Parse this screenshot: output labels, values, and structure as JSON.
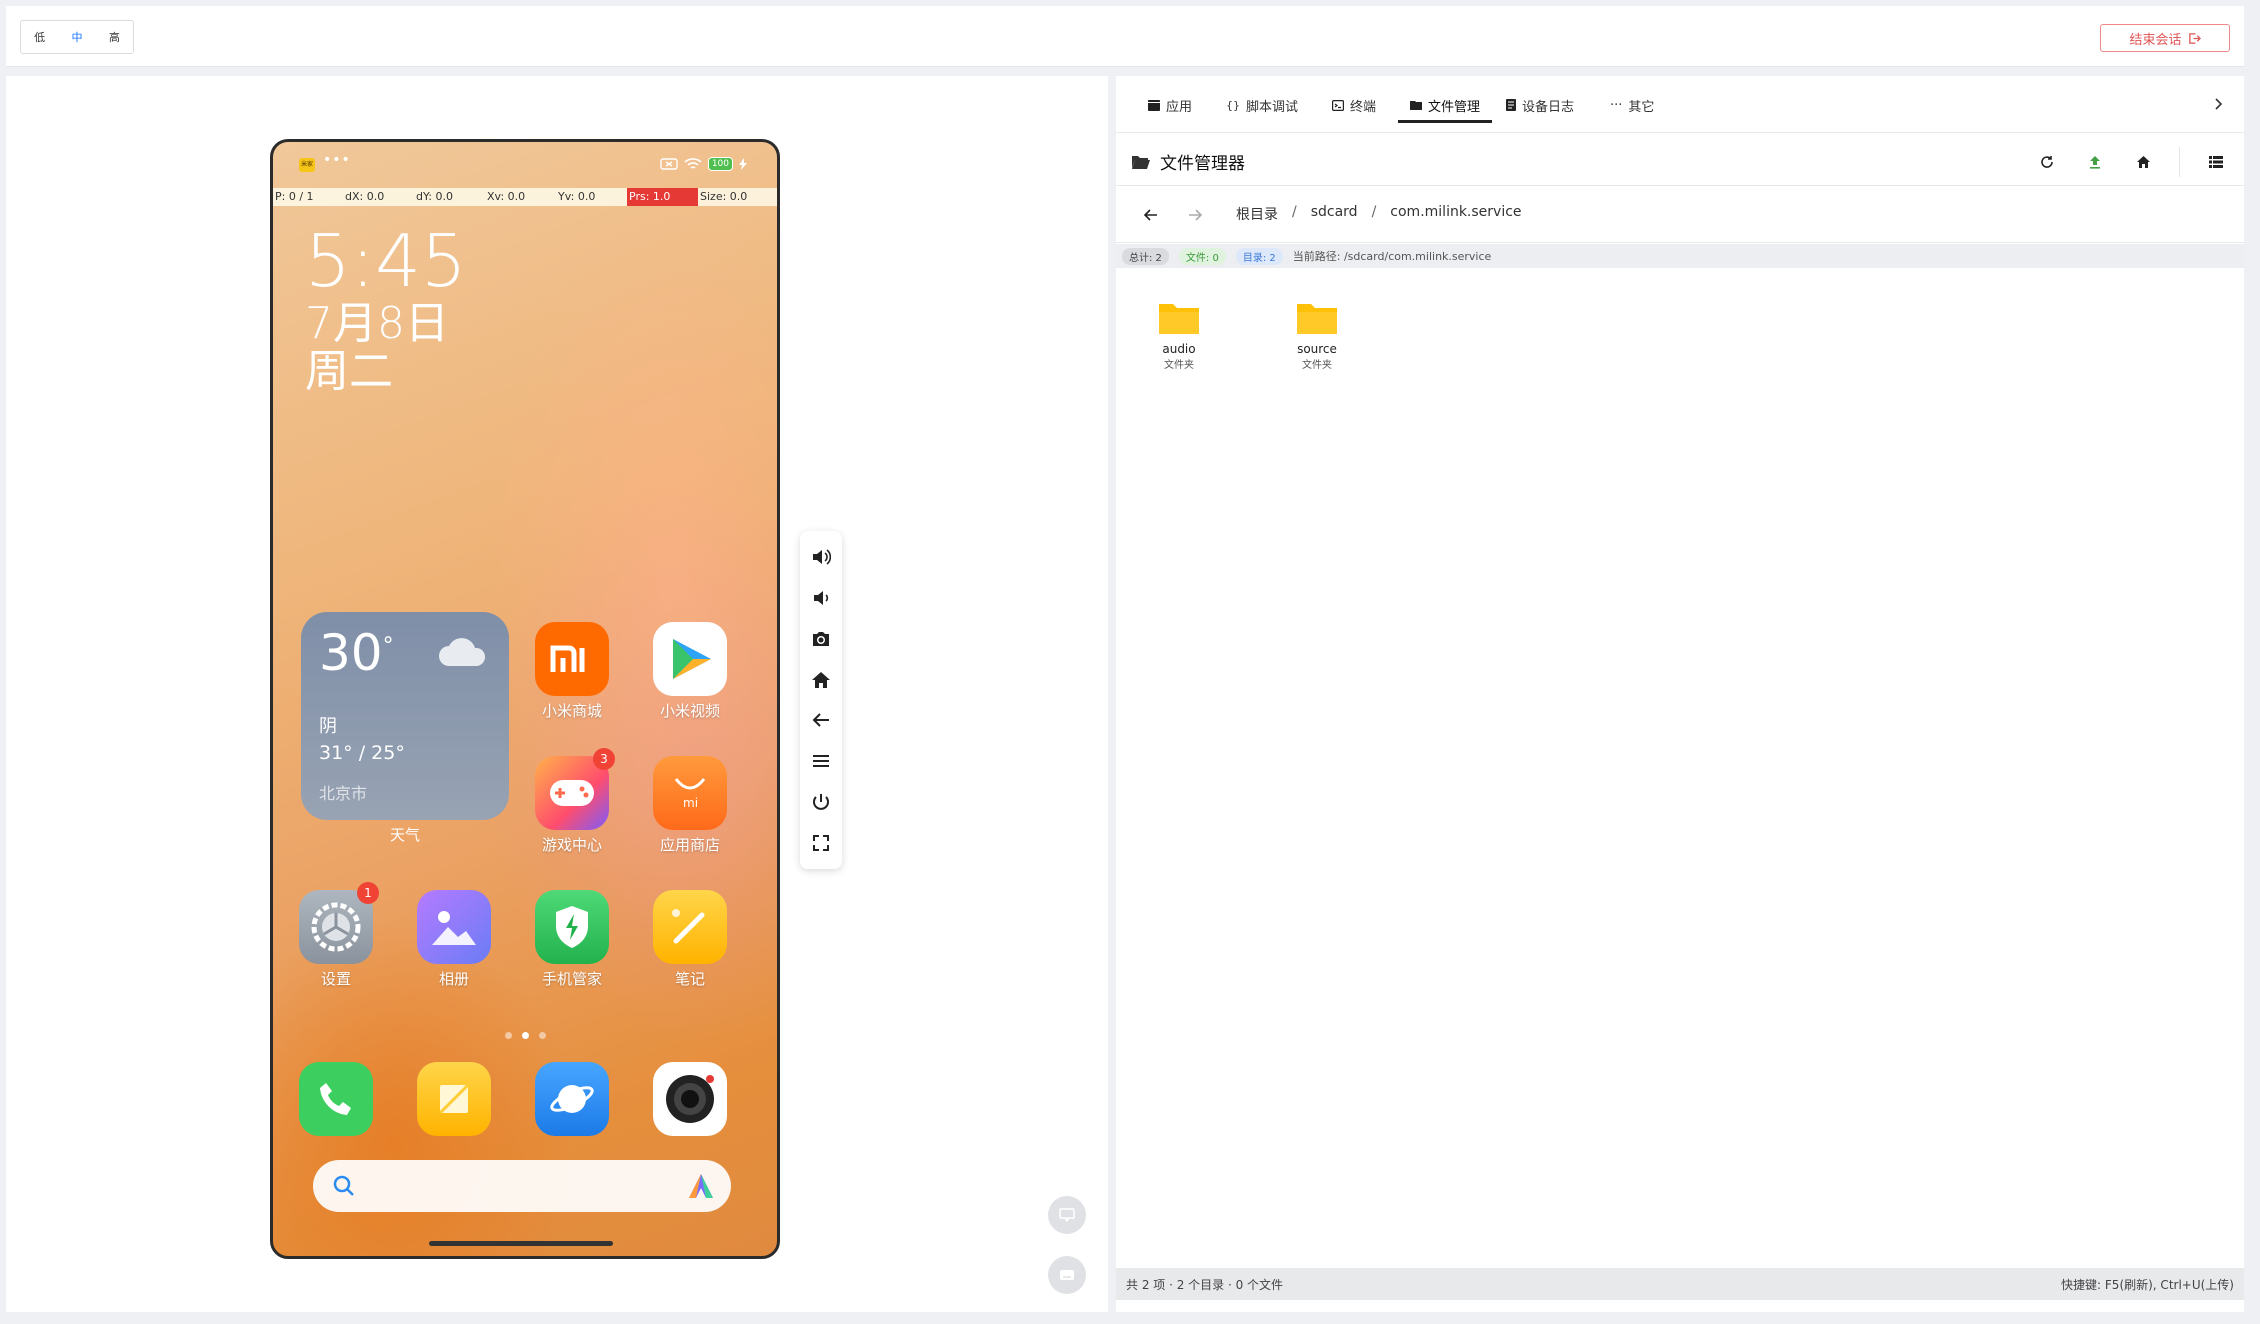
{
  "topbar": {
    "quality": [
      "低",
      "中",
      "高"
    ],
    "quality_active": "中",
    "end_session_label": "结束会话"
  },
  "phone": {
    "status": {
      "badge": "米家",
      "dots": "•••",
      "battery": "100"
    },
    "dev_overlay": [
      "P: 0 / 1",
      "dX: 0.0",
      "dY: 0.0",
      "Xv: 0.0",
      "Yv: 0.0",
      "Prs: 1.0",
      "Size: 0.0"
    ],
    "clock": {
      "time": "5:45",
      "date": "7月8日",
      "weekday": "周二"
    },
    "weather": {
      "temp": "30",
      "degree": "°",
      "condition": "阴",
      "range": "31° / 25°",
      "city": "北京市",
      "label": "天气"
    },
    "apps": [
      {
        "label": "小米商城",
        "icon": "mi-store-icon",
        "color": "#ff6a00"
      },
      {
        "label": "小米视频",
        "icon": "mi-video-icon",
        "color": "#ffffff"
      },
      {
        "label": "游戏中心",
        "icon": "game-center-icon",
        "color": "#ff5a5a",
        "badge": "3"
      },
      {
        "label": "应用商店",
        "icon": "app-store-icon",
        "color": "#ff7a1a"
      },
      {
        "label": "设置",
        "icon": "settings-icon",
        "color": "#9aa3ad",
        "badge": "1"
      },
      {
        "label": "相册",
        "icon": "gallery-icon",
        "color": "#8c7cf0"
      },
      {
        "label": "手机管家",
        "icon": "security-icon",
        "color": "#32c35a"
      },
      {
        "label": "笔记",
        "icon": "notes-icon",
        "color": "#ffc21a"
      }
    ],
    "dock": [
      {
        "icon": "phone-icon",
        "color": "#3ccf5f"
      },
      {
        "icon": "notes-dock-icon",
        "color": "#ffc83a"
      },
      {
        "icon": "browser-icon",
        "color": "#2a8cf0"
      },
      {
        "icon": "camera-icon",
        "color": "#ffffff"
      }
    ]
  },
  "side_toolbar": [
    "volume-up-icon",
    "volume-down-icon",
    "screenshot-icon",
    "home-icon",
    "back-icon",
    "menu-icon",
    "power-icon",
    "fullscreen-icon"
  ],
  "right": {
    "tabs": [
      {
        "label": "应用",
        "icon": "app-tab-icon"
      },
      {
        "label": "脚本调试",
        "icon": "code-icon"
      },
      {
        "label": "终端",
        "icon": "terminal-icon"
      },
      {
        "label": "文件管理",
        "icon": "folder-tab-icon"
      },
      {
        "label": "设备日志",
        "icon": "log-icon"
      },
      {
        "label": "其它",
        "icon": "more-icon"
      }
    ],
    "active_tab": "文件管理",
    "fm_title": "文件管理器",
    "breadcrumb": [
      "根目录",
      "sdcard",
      "com.milink.service"
    ],
    "info": {
      "total": "总计: 2",
      "files": "文件: 0",
      "dirs": "目录: 2",
      "path": "当前路径: /sdcard/com.milink.service"
    },
    "files": [
      {
        "name": "audio",
        "type": "文件夹"
      },
      {
        "name": "source",
        "type": "文件夹"
      }
    ],
    "footer_left": "共 2 项 · 2 个目录 · 0 个文件",
    "footer_right": "快捷键: F5(刷新), Ctrl+U(上传)"
  },
  "colors": {
    "accent": "#1677ff",
    "danger": "#e05555",
    "folder": "#ffc107",
    "upload": "#43a047"
  }
}
